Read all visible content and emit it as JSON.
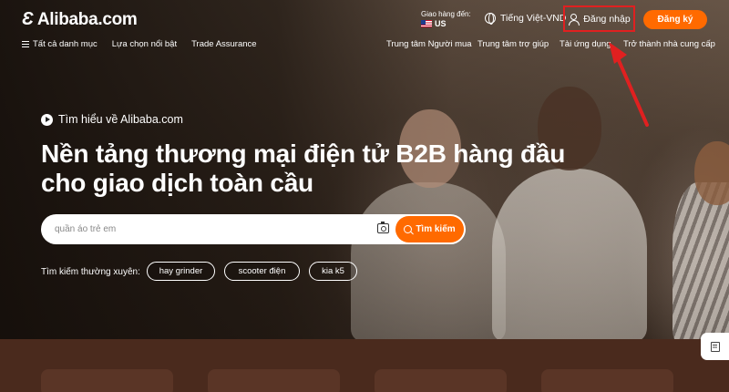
{
  "header": {
    "logo_mark": "Ɛ",
    "logo_text": "Alibaba.com",
    "ship_to_label": "Giao hàng đến:",
    "ship_to_country": "US",
    "language": "Tiếng Việt-VND",
    "login": "Đăng nhập",
    "signup": "Đăng ký"
  },
  "nav": {
    "left": [
      "Tất cả danh mục",
      "Lựa chọn nổi bật",
      "Trade Assurance"
    ],
    "right": [
      "Trung tâm Người mua",
      "Trung tâm trợ giúp",
      "Tải ứng dụng",
      "Trở thành nhà cung cấp"
    ]
  },
  "hero": {
    "learn_more": "Tìm hiểu về Alibaba.com",
    "headline_line1": "Nền tảng thương mại điện tử B2B hàng đầu",
    "headline_line2": "cho giao dịch toàn cầu"
  },
  "search": {
    "placeholder": "quần áo trẻ em",
    "button": "Tìm kiếm"
  },
  "frequent": {
    "label": "Tìm kiếm thường xuyên:",
    "chips": [
      "hay grinder",
      "scooter điện",
      "kia k5"
    ]
  },
  "colors": {
    "accent": "#ff6a00",
    "highlight": "#e02020"
  }
}
